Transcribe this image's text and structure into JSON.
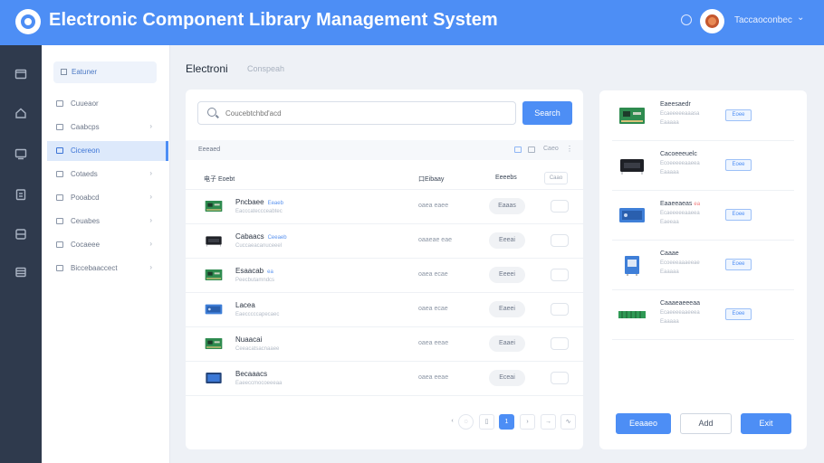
{
  "header": {
    "title": "Electronic Component Library Management System",
    "user": "Taccaoconbec",
    "bell_icon": "bell-icon",
    "avatar_icon": "avatar"
  },
  "rail": {
    "icons": [
      "folder-icon",
      "home-icon",
      "monitor-icon",
      "clipboard-icon",
      "database-icon",
      "storage-icon"
    ]
  },
  "sidebar": {
    "top_label": "Eatuner",
    "items": [
      {
        "label": "Cuueaor",
        "chevron": ""
      },
      {
        "label": "Caabcps",
        "chevron": "›"
      },
      {
        "label": "Cicereon",
        "chevron": "",
        "active": true
      },
      {
        "label": "Cotaeds",
        "chevron": "›"
      },
      {
        "label": "Pooabcd",
        "chevron": "›"
      },
      {
        "label": "Ceuabes",
        "chevron": "›"
      },
      {
        "label": "Cocaeee",
        "chevron": "›"
      },
      {
        "label": "Biccebaaccect",
        "chevron": "›"
      }
    ]
  },
  "breadcrumb": {
    "current": "Electroni",
    "next": "Conspeah"
  },
  "search": {
    "placeholder": "Coucebtchbd'acd",
    "button": "Search"
  },
  "list": {
    "label": "Eeeaed",
    "sort_label": "Caeo",
    "more": "⋮",
    "columns": [
      "电子 Eoebt",
      "口Eibaay",
      "Eeeebs"
    ],
    "column4_label": "Caao",
    "rows": [
      {
        "name": "Pncbaee",
        "tag": "Eeaeb",
        "sub": "Eacccateccceabtec",
        "qty": "oaea eaee",
        "status": "Eaaas",
        "thumb": "green-board"
      },
      {
        "name": "Cabaacs",
        "tag": "Ceeaeb",
        "sub": "Cuccaeacanuceeel",
        "qty": "oaaeae eae",
        "status": "Eeeai",
        "thumb": "black-module"
      },
      {
        "name": "Esaacab",
        "tag": "ea",
        "sub": "Peecbutamndcs",
        "qty": "oaea ecae",
        "status": "Eeeei",
        "thumb": "green-board"
      },
      {
        "name": "Lacea",
        "tag": "",
        "sub": "Eaecccccapecaec",
        "qty": "oaea ecae",
        "status": "Eaeei",
        "thumb": "blue-board"
      },
      {
        "name": "Nuaacai",
        "tag": "",
        "sub": "Ceeacatsacnaaee",
        "qty": "oaea eeae",
        "status": "Eaaei",
        "thumb": "green-board"
      },
      {
        "name": "Becaaacs",
        "tag": "",
        "sub": "Eaeeccmocoeeeaa",
        "qty": "oaea eeae",
        "status": "Eceai",
        "thumb": "blue-display"
      }
    ]
  },
  "pager": [
    "‹",
    "◌",
    "▯",
    "1",
    "›",
    "→",
    "∿"
  ],
  "right_panel": {
    "items": [
      {
        "title": "Eaeesaedr",
        "hot": "",
        "line1": "Ecaeeeeeaaasa",
        "line2": "Eaaaaa",
        "chip": "Eoee",
        "img": "green-board"
      },
      {
        "title": "Cacoeeeuelc",
        "hot": "",
        "line1": "Ecoeeeeeaaeea",
        "line2": "Eaaaaa",
        "chip": "Eoee",
        "img": "black-module"
      },
      {
        "title": "Eaaeeaeas",
        "hot": "ea",
        "line1": "Ecaeeeeeaaeea",
        "line2": "Eaeeaa",
        "chip": "Eoee",
        "img": "blue-board"
      },
      {
        "title": "Caaae",
        "hot": "",
        "line1": "Ecoeeeaaaeeae",
        "line2": "Eaaaaa",
        "chip": "Eoee",
        "img": "blue-connector"
      },
      {
        "title": "Caaaeaeeeaa",
        "hot": "",
        "line1": "Ecaeeeeaaeeea",
        "line2": "Eaaaaa",
        "chip": "Eoee",
        "img": "green-strip"
      }
    ],
    "buttons": {
      "primary": "Eeaaeo",
      "add": "Add",
      "exit": "Exit"
    }
  },
  "colors": {
    "accent": "#4d8ef5",
    "rail": "#2f3a4d",
    "background": "#eef1f6"
  }
}
